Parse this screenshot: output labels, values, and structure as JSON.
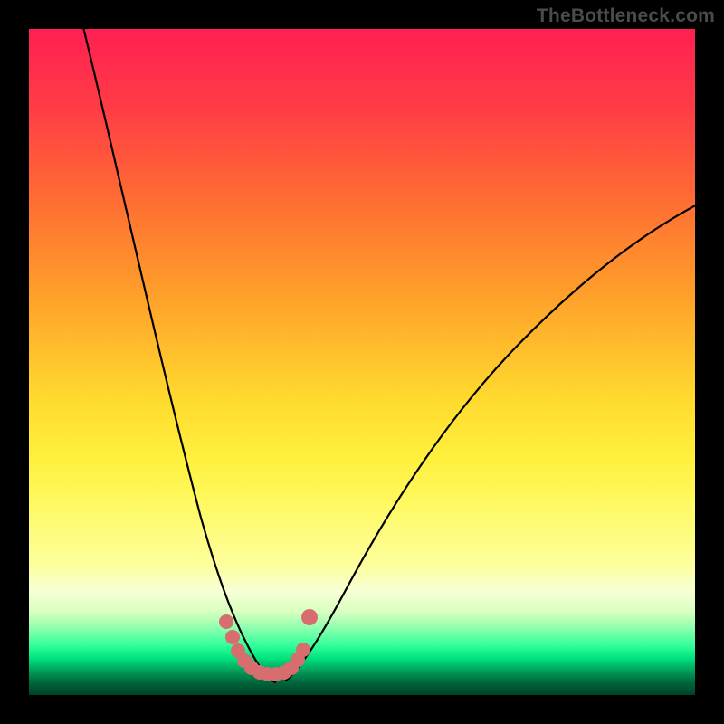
{
  "watermark": "TheBottleneck.com",
  "colors": {
    "background": "#000000",
    "curve_stroke": "#000000",
    "marker_fill": "#d86d70",
    "gradient_top": "#ff1f52",
    "gradient_bottom": "#004127"
  },
  "chart_data": {
    "type": "line",
    "title": "",
    "xlabel": "",
    "ylabel": "",
    "xlim": [
      0,
      100
    ],
    "ylim": [
      0,
      100
    ],
    "grid": false,
    "note": "No axis tick labels or numeric values are rendered in the image; values below are estimated from pixel positions of the plotted curves.",
    "series": [
      {
        "name": "left-curve",
        "x": [
          7,
          10,
          13,
          16,
          19,
          22,
          25,
          27,
          29,
          31,
          33,
          35
        ],
        "y": [
          100,
          85,
          70,
          56,
          43,
          32,
          22,
          15,
          10,
          7,
          5,
          4
        ]
      },
      {
        "name": "right-curve",
        "x": [
          38,
          41,
          45,
          50,
          55,
          60,
          66,
          72,
          78,
          85,
          92,
          100
        ],
        "y": [
          4,
          7,
          12,
          19,
          27,
          34,
          41,
          48,
          55,
          62,
          68,
          74
        ]
      },
      {
        "name": "bottom-markers",
        "type": "scatter",
        "x": [
          29.5,
          30.5,
          31.5,
          32.5,
          33.5,
          34.5,
          35.5,
          36.5,
          37.5,
          38.5,
          39.5,
          40.5,
          41
        ],
        "y": [
          11,
          8.5,
          6.5,
          5.3,
          4.5,
          4.0,
          3.8,
          3.8,
          4.0,
          4.5,
          5.5,
          7.0,
          12
        ]
      }
    ]
  }
}
